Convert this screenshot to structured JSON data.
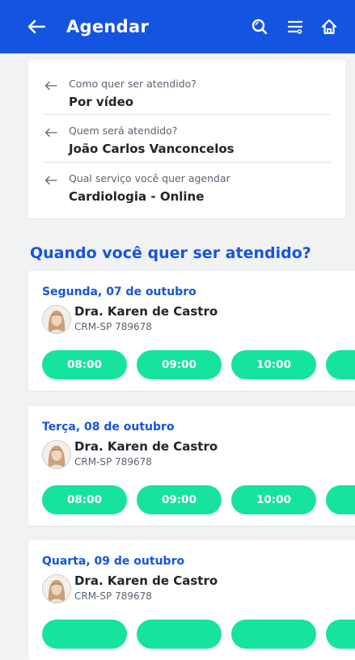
{
  "header": {
    "back_icon": "arrow-left-icon",
    "title": "Agendar",
    "actions": [
      "search-icon",
      "filter-list-icon",
      "home-icon"
    ]
  },
  "summary": {
    "items": [
      {
        "question": "Como quer ser atendido?",
        "answer": "Por vídeo"
      },
      {
        "question": "Quem será atendido?",
        "answer": "João Carlos Vanconcelos"
      },
      {
        "question": "Qual serviço você quer agendar",
        "answer": "Cardiologia - Online"
      }
    ]
  },
  "section_title": "Quando você quer ser atendido?",
  "days": [
    {
      "date": "Segunda, 07 de outubro",
      "doctor": "Dra. Karen de Castro",
      "crm": "CRM-SP 789678",
      "slots": [
        "08:00",
        "09:00",
        "10:00"
      ]
    },
    {
      "date": "Terça, 08 de outubro",
      "doctor": "Dra. Karen de Castro",
      "crm": "CRM-SP 789678",
      "slots": [
        "08:00",
        "09:00",
        "10:00"
      ]
    },
    {
      "date": "Quarta, 09 de outubro",
      "doctor": "Dra. Karen de Castro",
      "crm": "CRM-SP 789678",
      "slots": [
        "",
        "",
        ""
      ]
    }
  ],
  "colors": {
    "primary": "#1554e0",
    "slot": "#16e3a0",
    "background": "#f1f2f4"
  }
}
